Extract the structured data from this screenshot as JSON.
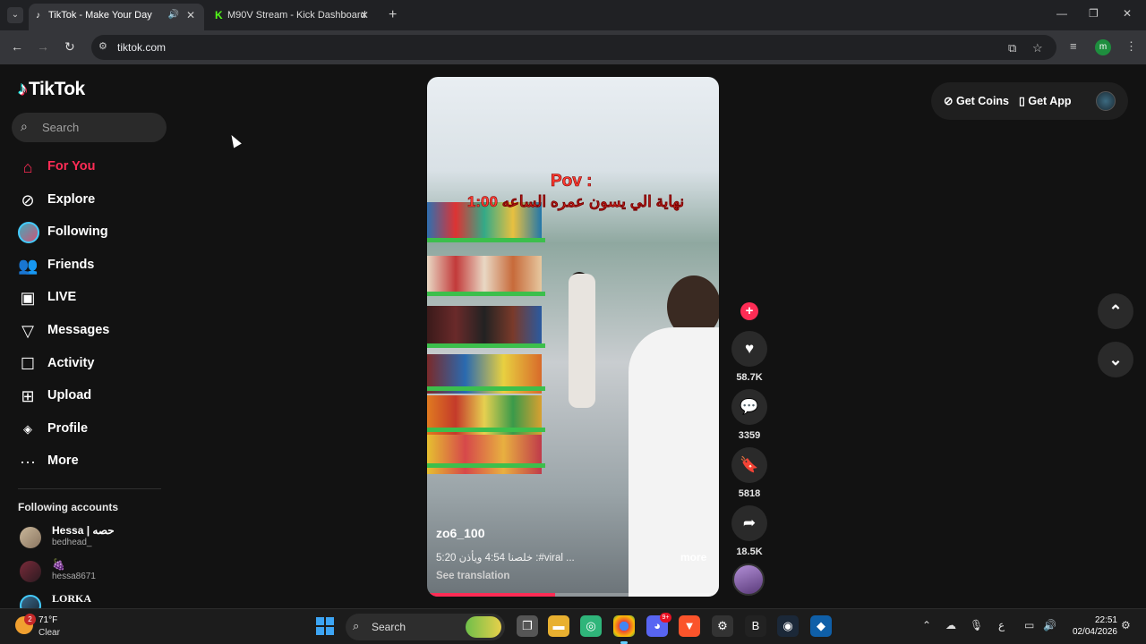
{
  "browser": {
    "tabs": [
      {
        "title": "TikTok - Make Your Day",
        "favicon": "tiktok-icon",
        "active": true,
        "audio": true
      },
      {
        "title": "M90V Stream - Kick Dashboard",
        "favicon": "kick-icon",
        "active": false
      }
    ],
    "url": "tiktok.com",
    "profile_initial": "m"
  },
  "sidebar": {
    "logo": "TikTok",
    "search_placeholder": "Search",
    "nav": [
      {
        "label": "For You",
        "icon": "home-icon",
        "active": true
      },
      {
        "label": "Explore",
        "icon": "compass-icon"
      },
      {
        "label": "Following",
        "icon": "following-avatar-icon"
      },
      {
        "label": "Friends",
        "icon": "friends-icon"
      },
      {
        "label": "LIVE",
        "icon": "live-tv-icon"
      },
      {
        "label": "Messages",
        "icon": "send-icon"
      },
      {
        "label": "Activity",
        "icon": "activity-icon"
      },
      {
        "label": "Upload",
        "icon": "plus-square-icon"
      },
      {
        "label": "Profile",
        "icon": "profile-avatar-icon"
      },
      {
        "label": "More",
        "icon": "more-dots-icon"
      }
    ],
    "following_title": "Following accounts",
    "accounts": [
      {
        "name": "Hessa | حصه",
        "handle": "bedhead_"
      },
      {
        "name": "🍇",
        "handle": "hessa8671"
      },
      {
        "name": "LORKA",
        "handle": ""
      }
    ]
  },
  "video": {
    "overlay_title": "Pov :",
    "overlay_text": "نهاية الي يسون عمره الساعه 1:00",
    "username": "zo6_100",
    "caption": "5:20 خلصنا 4:54 ويأذن :#viral ...",
    "more_label": "more",
    "translate_label": "See translation",
    "progress": 0.44
  },
  "actions": {
    "likes": "58.7K",
    "comments": "3359",
    "saves": "5818",
    "shares": "18.5K"
  },
  "topbar": {
    "coins_label": "Get Coins",
    "app_label": "Get App"
  },
  "taskbar": {
    "weather_temp": "71°F",
    "weather_cond": "Clear",
    "weather_badge": "2",
    "search_label": "Search",
    "discord_badge": "9+",
    "ime": "ع",
    "time": "22:51",
    "date": "02/04/2026"
  },
  "colors": {
    "accent": "#fe2c55",
    "background": "#121212"
  }
}
